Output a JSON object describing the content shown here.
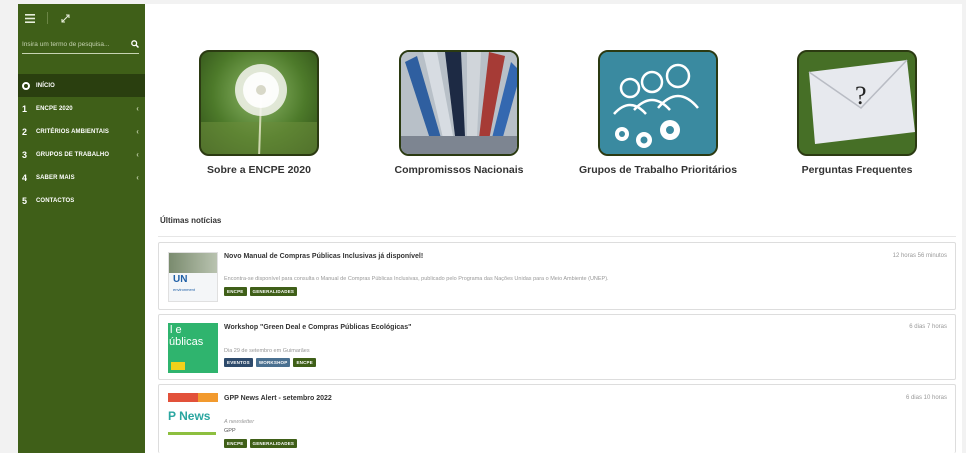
{
  "sidebar": {
    "search_placeholder": "Insira um termo de pesquisa...",
    "items": [
      {
        "num": "",
        "label": "INÍCIO"
      },
      {
        "num": "1",
        "label": "ENCPE 2020"
      },
      {
        "num": "2",
        "label": "CRITÉRIOS AMBIENTAIS"
      },
      {
        "num": "3",
        "label": "GRUPOS DE TRABALHO"
      },
      {
        "num": "4",
        "label": "SABER MAIS"
      },
      {
        "num": "5",
        "label": "CONTACTOS"
      }
    ]
  },
  "tiles": [
    {
      "label": "Sobre a ENCPE 2020"
    },
    {
      "label": "Compromissos Nacionais"
    },
    {
      "label": "Grupos de Trabalho Prioritários"
    },
    {
      "label": "Perguntas Frequentes"
    }
  ],
  "news": {
    "heading": "Últimas notícias",
    "items": [
      {
        "title": "Novo Manual de Compras Públicas Inclusivas já disponível!",
        "time": "12 horas 56 minutos",
        "desc": "Encontra-se disponível para consulta o Manual de Compras Públicas Inclusivas, publicado pelo Programa das Nações Unidas para o Meio Ambiente (UNEP).",
        "desc2": "",
        "tags": [
          "ENCPE",
          "GENERALIDADES"
        ],
        "thumb_text": "UN",
        "thumb_text2": "environment"
      },
      {
        "title": "Workshop \"Green Deal e Compras Públicas Ecológicas\"",
        "time": "6 dias 7 horas",
        "desc": "Dia 29 de setembro em Guimarães",
        "desc2": "",
        "tags": [
          "EVENTOS",
          "WORKSHOP",
          "ENCPE"
        ],
        "thumb_text": "l e",
        "thumb_text2": "úblicas"
      },
      {
        "title": "GPP News Alert - setembro 2022",
        "time": "6 dias 10 horas",
        "desc": "A newsletter",
        "desc2": "GPP",
        "tags": [
          "ENCPE",
          "GENERALIDADES"
        ],
        "thumb_text": "P News",
        "thumb_text2": ""
      }
    ]
  }
}
